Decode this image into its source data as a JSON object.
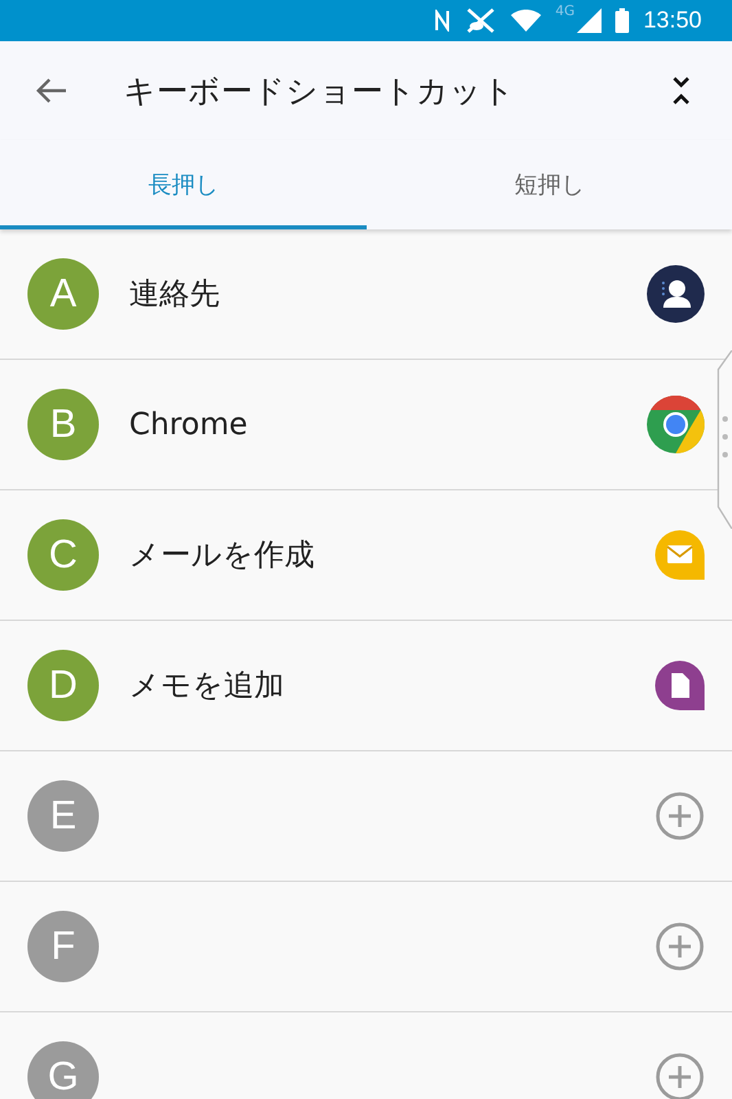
{
  "status_bar": {
    "network": "4G",
    "time": "13:50"
  },
  "header": {
    "title": "キーボードショートカット"
  },
  "tabs": [
    {
      "label": "長押し",
      "selected": true
    },
    {
      "label": "短押し",
      "selected": false
    }
  ],
  "shortcuts": [
    {
      "letter": "A",
      "assigned": true,
      "name": "連絡先",
      "kind": "contacts"
    },
    {
      "letter": "B",
      "assigned": true,
      "name": "Chrome",
      "kind": "chrome"
    },
    {
      "letter": "C",
      "assigned": true,
      "name": "メールを作成",
      "kind": "mail"
    },
    {
      "letter": "D",
      "assigned": true,
      "name": "メモを追加",
      "kind": "memo"
    },
    {
      "letter": "E",
      "assigned": false
    },
    {
      "letter": "F",
      "assigned": false
    },
    {
      "letter": "G",
      "assigned": false
    }
  ]
}
